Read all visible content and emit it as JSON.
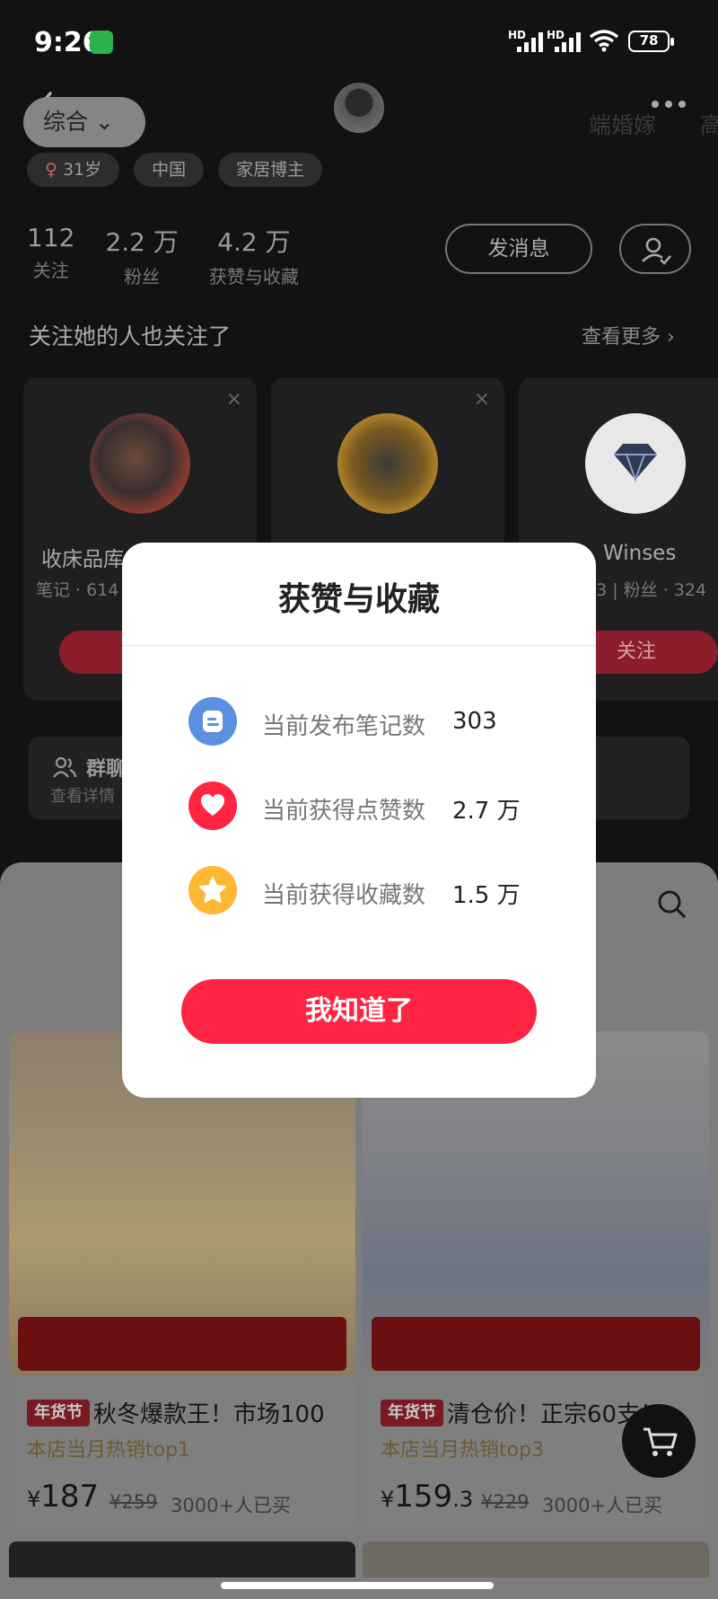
{
  "status_bar": {
    "time": "9:26",
    "battery": "78",
    "sig1": "HD",
    "sig2": "HD"
  },
  "profile": {
    "tags": [
      "31岁",
      "中国",
      "家居博主"
    ],
    "gender_symbol": "♀",
    "stats": [
      {
        "num": "112",
        "label": "关注"
      },
      {
        "num": "2.2 万",
        "label": "粉丝"
      },
      {
        "num": "4.2 万",
        "label": "获赞与收藏"
      }
    ],
    "message_button": "发消息"
  },
  "recommend": {
    "title": "关注她的人也关注了",
    "more": "查看更多",
    "cards": [
      {
        "name": "收床品库",
        "sub": "笔记 · 614",
        "follow": "",
        "close": "×"
      },
      {
        "name": "",
        "sub": "",
        "follow": "",
        "close": "×"
      },
      {
        "name": "Winses",
        "sub": "· 3 | 粉丝 · 324",
        "follow": "关注",
        "close": ""
      }
    ]
  },
  "group": {
    "title": "群聊",
    "detail": "查看详情"
  },
  "shop": {
    "sort_label": "综合",
    "filters": [
      "端婚嫁",
      "高"
    ],
    "products": [
      {
        "badge": "年货节",
        "title": "秋冬爆款王！市场100",
        "subtitle": "本店当月热销top1",
        "currency": "¥",
        "price": "187",
        "price_decimal": "",
        "old_price": "¥259",
        "sold": "3000+人已买"
      },
      {
        "badge": "年货节",
        "title": "清仓价！正宗60支！",
        "subtitle": "本店当月热销top3",
        "currency": "¥",
        "price": "159",
        "price_decimal": ".3",
        "old_price": "¥229",
        "sold": "3000+人已买"
      }
    ]
  },
  "dialog": {
    "title": "获赞与收藏",
    "rows": [
      {
        "label": "当前发布笔记数",
        "value": "303",
        "icon": "notes-icon",
        "color": "#5b8fe0"
      },
      {
        "label": "当前获得点赞数",
        "value": "2.7 万",
        "icon": "heart-icon",
        "color": "#ff2442"
      },
      {
        "label": "当前获得收藏数",
        "value": "1.5 万",
        "icon": "star-icon",
        "color": "#ffb834"
      }
    ],
    "ok_button": "我知道了"
  }
}
